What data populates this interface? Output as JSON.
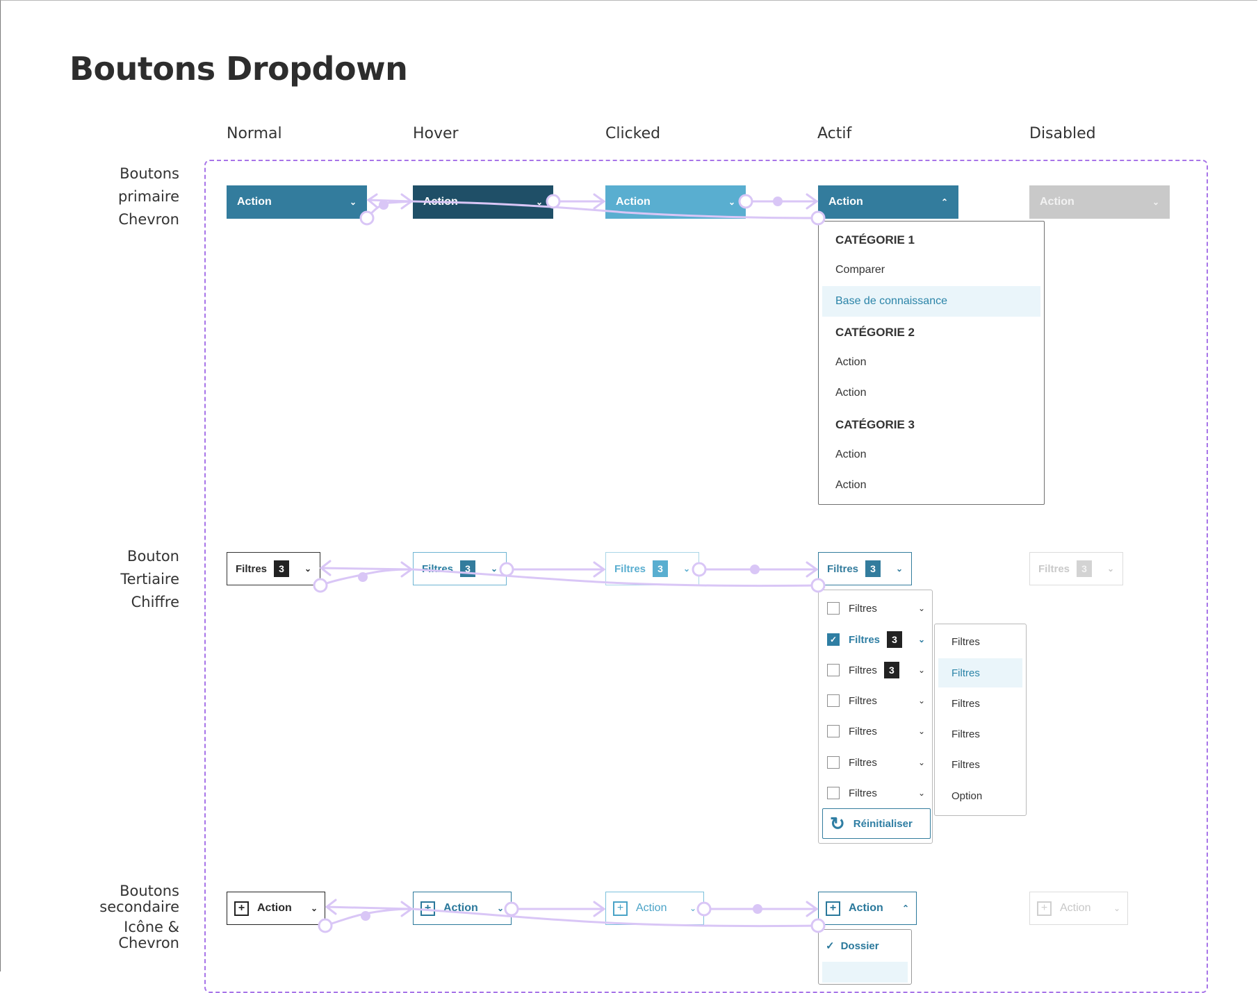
{
  "page": {
    "title": "Boutons Dropdown"
  },
  "columns": [
    "Normal",
    "Hover",
    "Clicked",
    "Actif",
    "Disabled"
  ],
  "rows": {
    "primary": {
      "label_lines": [
        "Boutons",
        "primaire",
        "Chevron"
      ]
    },
    "tertiary": {
      "label_lines": [
        "Bouton",
        "Tertiaire",
        "Chiffre"
      ]
    },
    "secondary": {
      "label_lines": [
        "Boutons",
        "secondaire",
        "Icône &",
        "Chevron"
      ]
    }
  },
  "primary_buttons": {
    "label": "Action",
    "chevron_closed": "⌄",
    "chevron_open": "⌃",
    "colors": {
      "normal": "#337c9d",
      "hover": "#1f4f67",
      "clicked": "#59aed0",
      "disabled": "#c9c9c9"
    }
  },
  "primary_menu": {
    "items": [
      {
        "kind": "category",
        "text": "CATÉGORIE 1"
      },
      {
        "kind": "item",
        "text": "Comparer"
      },
      {
        "kind": "highlight",
        "text": "Base de connaissance"
      },
      {
        "kind": "category",
        "text": "CATÉGORIE 2"
      },
      {
        "kind": "item",
        "text": "Action"
      },
      {
        "kind": "item",
        "text": "Action"
      },
      {
        "kind": "category",
        "text": "CATÉGORIE 3"
      },
      {
        "kind": "item",
        "text": "Action"
      },
      {
        "kind": "item",
        "text": "Action"
      }
    ]
  },
  "tertiary_buttons": {
    "label": "Filtres",
    "count": "3"
  },
  "filter_menu": {
    "rows": [
      {
        "label": "Filtres",
        "checked": false,
        "count": ""
      },
      {
        "label": "Filtres",
        "checked": true,
        "count": "3"
      },
      {
        "label": "Filtres",
        "checked": false,
        "count": "3"
      },
      {
        "label": "Filtres",
        "checked": false,
        "count": ""
      },
      {
        "label": "Filtres",
        "checked": false,
        "count": ""
      },
      {
        "label": "Filtres",
        "checked": false,
        "count": ""
      },
      {
        "label": "Filtres",
        "checked": false,
        "count": ""
      }
    ],
    "reset_label": "Réinitialiser"
  },
  "submenu": {
    "options": [
      {
        "text": "Filtres",
        "highlight": false
      },
      {
        "text": "Filtres",
        "highlight": true
      },
      {
        "text": "Filtres",
        "highlight": false
      },
      {
        "text": "Filtres",
        "highlight": false
      },
      {
        "text": "Filtres",
        "highlight": false
      },
      {
        "text": "Option",
        "highlight": false
      }
    ]
  },
  "secondary_buttons": {
    "label": "Action"
  },
  "secondary_menu": {
    "item": "Dossier"
  },
  "accent": {
    "primary": "#337c9d",
    "prototype_flow": "#d9c6f6",
    "frame_dash": "#a774e8"
  }
}
